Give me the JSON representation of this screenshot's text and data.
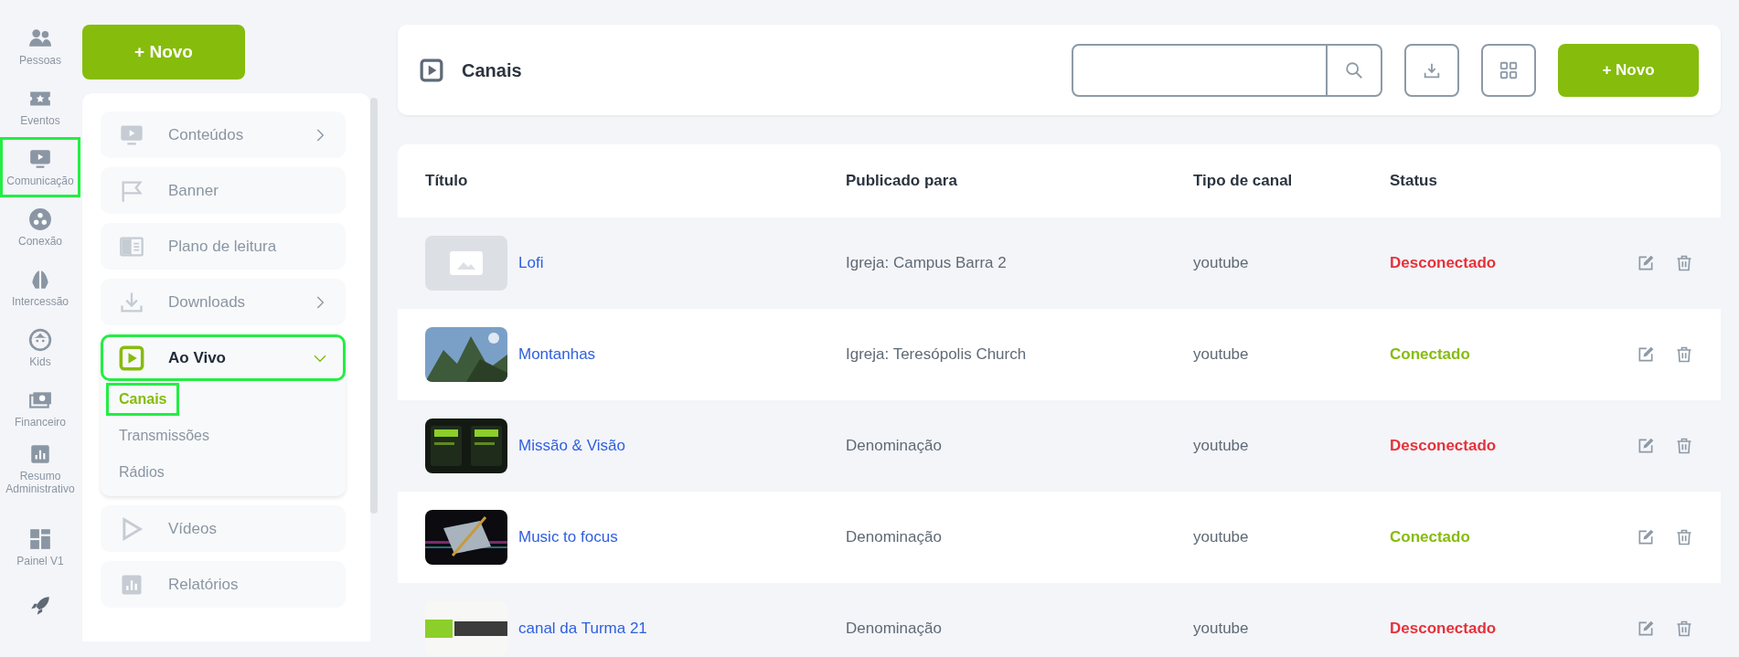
{
  "rail": [
    {
      "label": "Pessoas",
      "highlighted": false
    },
    {
      "label": "Eventos",
      "highlighted": false
    },
    {
      "label": "Comunicação",
      "highlighted": true
    },
    {
      "label": "Conexão",
      "highlighted": false
    },
    {
      "label": "Intercessão",
      "highlighted": false
    },
    {
      "label": "Kids",
      "highlighted": false
    },
    {
      "label": "Financeiro",
      "highlighted": false
    },
    {
      "label": "Resumo Administrativo",
      "highlighted": false
    }
  ],
  "rail_bottom": [
    {
      "label": "Painel V1",
      "highlighted": false
    },
    {
      "highlighted": false
    }
  ],
  "new_button": "+ Novo",
  "menu": [
    {
      "label": "Conteúdos",
      "expandable": true,
      "expanded": false,
      "highlighted": false
    },
    {
      "label": "Banner",
      "expandable": false,
      "expanded": false,
      "highlighted": false
    },
    {
      "label": "Plano de leitura",
      "expandable": false,
      "expanded": false,
      "highlighted": false
    },
    {
      "label": "Downloads",
      "expandable": true,
      "expanded": false,
      "highlighted": false
    },
    {
      "label": "Ao Vivo",
      "expandable": true,
      "expanded": true,
      "highlighted": true,
      "children": [
        {
          "label": "Canais",
          "selected": true,
          "highlighted": true
        },
        {
          "label": "Transmissões",
          "selected": false,
          "highlighted": false
        },
        {
          "label": "Rádios",
          "selected": false,
          "highlighted": false
        }
      ]
    },
    {
      "label": "Vídeos",
      "expandable": false,
      "expanded": false,
      "highlighted": false
    },
    {
      "label": "Relatórios",
      "expandable": false,
      "expanded": false,
      "highlighted": false
    }
  ],
  "header": {
    "title": "Canais",
    "new_button": "+ Novo"
  },
  "table": {
    "columns": [
      "Título",
      "Publicado para",
      "Tipo de canal",
      "Status"
    ],
    "rows": [
      {
        "kind": "placeholder",
        "title": "Lofi",
        "published": "Igreja: Campus Barra 2",
        "type": "youtube",
        "status": "Desconectado",
        "connected": false
      },
      {
        "kind": "picture",
        "title": "Montanhas",
        "published": "Igreja: Teresópolis Church",
        "type": "youtube",
        "status": "Conectado",
        "connected": true
      },
      {
        "kind": "picture",
        "title": "Missão & Visão",
        "published": "Denominação",
        "type": "youtube",
        "status": "Desconectado",
        "connected": false
      },
      {
        "kind": "picture",
        "title": "Music to focus",
        "published": "Denominação",
        "type": "youtube",
        "status": "Conectado",
        "connected": true
      },
      {
        "kind": "picture",
        "title": "canal da Turma 21",
        "published": "Denominação",
        "type": "youtube",
        "status": "Desconectado",
        "connected": false
      }
    ]
  }
}
